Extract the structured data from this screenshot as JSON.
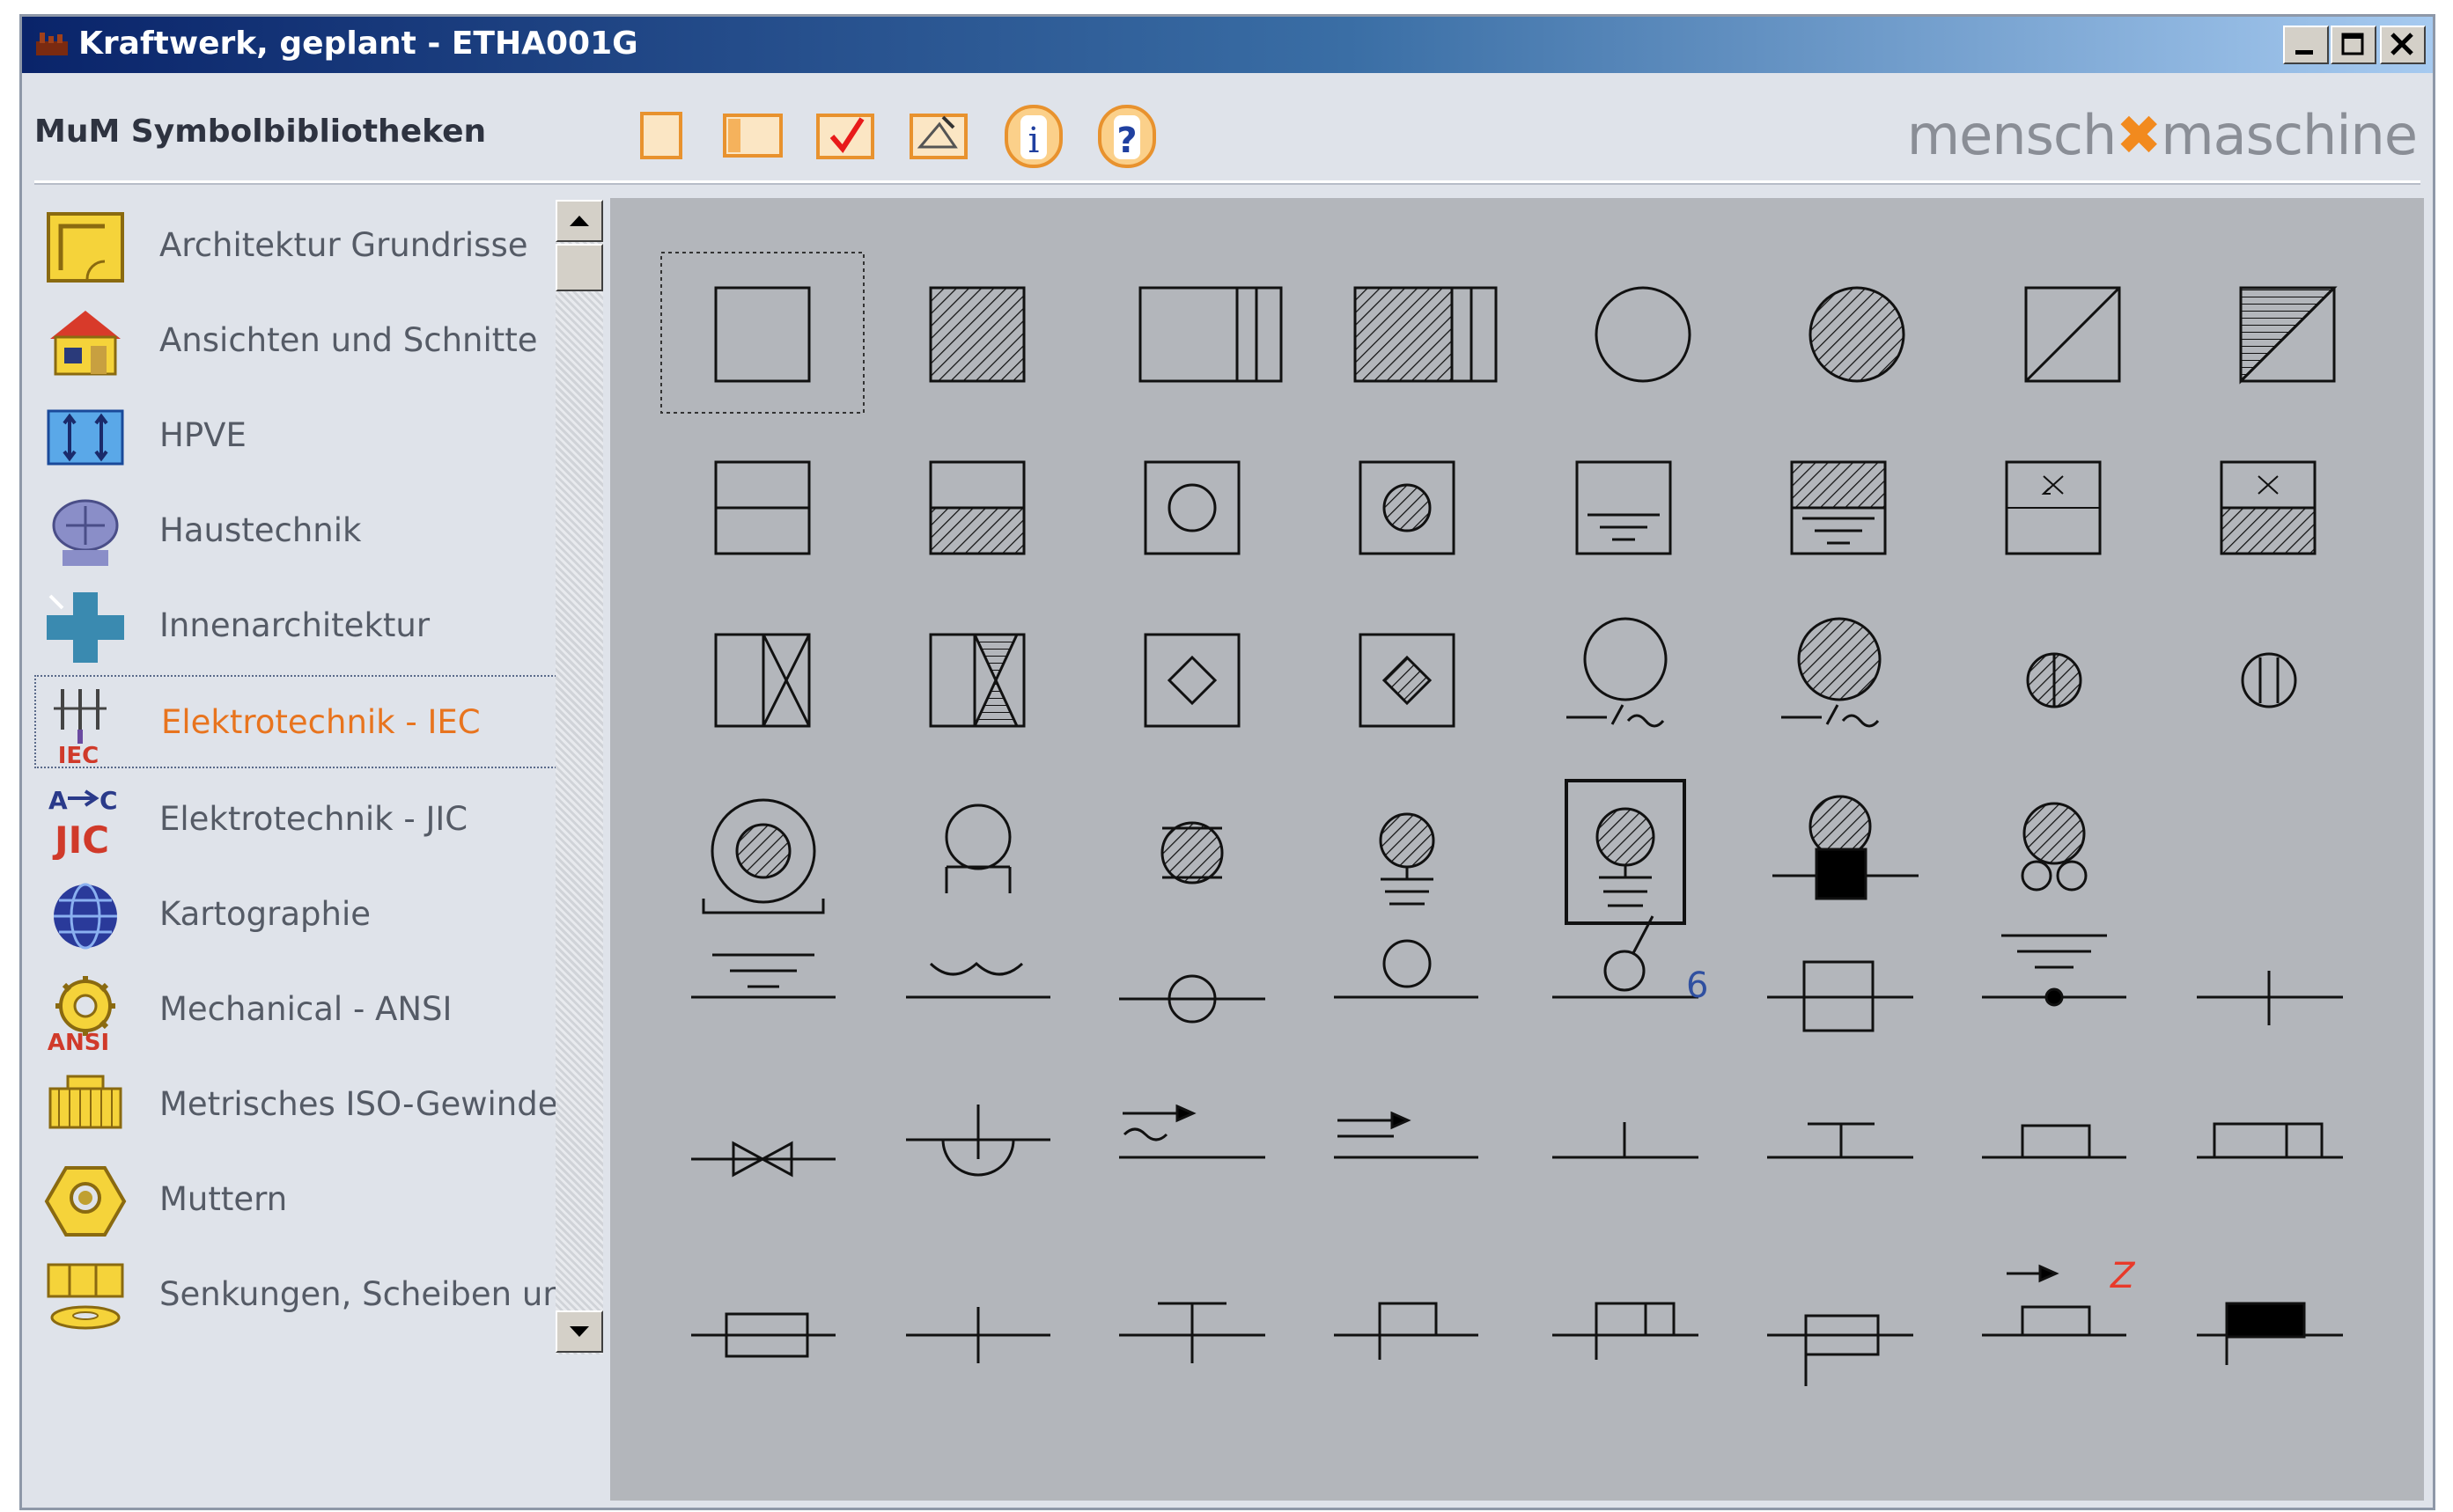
{
  "window": {
    "title": "Kraftwerk, geplant  -  ETHA001G"
  },
  "toolbar": {
    "library_title": "MuM Symbolbibliotheken",
    "buttons": [
      "new-icon",
      "panel-icon",
      "check-icon",
      "edit-icon",
      "info-icon",
      "help-icon"
    ],
    "brand_left": "mensch",
    "brand_x": "✖",
    "brand_right": "maschine"
  },
  "colors": {
    "accent": "#f28a1e",
    "selected_text": "#e8741e",
    "canvas_bg": "#b3b6bb"
  },
  "sidebar": {
    "items": [
      {
        "label": "Architektur Grundrisse",
        "icon": "floorplan-icon"
      },
      {
        "label": "Ansichten und Schnitte",
        "icon": "house-icon"
      },
      {
        "label": "HPVE",
        "icon": "hpve-icon"
      },
      {
        "label": "Haustechnik",
        "icon": "monitor-icon"
      },
      {
        "label": "Innenarchitektur",
        "icon": "cross-icon"
      },
      {
        "label": "Elektrotechnik - IEC",
        "icon": "iec-icon",
        "badge": "IEC",
        "selected": true
      },
      {
        "label": "Elektrotechnik - JIC",
        "icon": "jic-icon",
        "badge": "JIC"
      },
      {
        "label": "Kartographie",
        "icon": "globe-icon"
      },
      {
        "label": "Mechanical - ANSI",
        "icon": "gear-icon",
        "badge": "ANSI"
      },
      {
        "label": "Metrisches ISO-Gewinde",
        "icon": "thread-icon"
      },
      {
        "label": "Muttern",
        "icon": "nut-icon"
      },
      {
        "label": "Senkungen, Scheiben und Du",
        "icon": "washer-icon"
      }
    ]
  },
  "symbols": {
    "label_6": "6",
    "label_z": "Z"
  }
}
